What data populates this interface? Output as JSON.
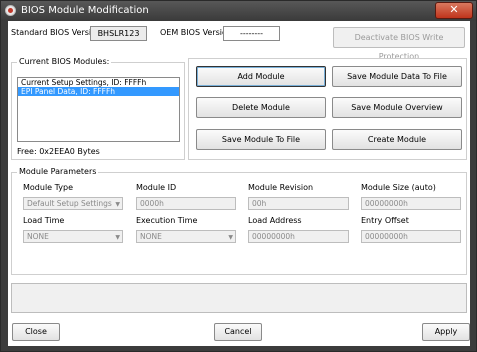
{
  "window": {
    "title": "BIOS Module Modification",
    "close_glyph": "✕"
  },
  "header": {
    "standard_label": "Standard BIOS Version:",
    "standard_value": "BHSLR123",
    "oem_label": "OEM BIOS Version:",
    "oem_value": "--------",
    "deactivate_label": "Deactivate BIOS Write Protection"
  },
  "modules": {
    "group_title": "Current BIOS Modules:",
    "items": [
      {
        "label": "Current Setup Settings, ID: FFFFh",
        "selected": false
      },
      {
        "label": "EPI Panel Data, ID: FFFFh",
        "selected": true
      }
    ],
    "free_text": "Free: 0x2EEA0 Bytes"
  },
  "actions": {
    "add": "Add  Module",
    "save_data": "Save Module Data To File",
    "delete": "Delete Module",
    "save_overview": "Save Module Overview",
    "save_to_file": "Save Module To File",
    "create": "Create Module"
  },
  "params": {
    "group_title": "Module Parameters",
    "type_label": "Module Type",
    "type_value": "Default Setup Settings",
    "id_label": "Module ID",
    "id_value": "0000h",
    "revision_label": "Module Revision",
    "revision_value": "00h",
    "size_label": "Module Size (auto)",
    "size_value": "00000000h",
    "load_time_label": "Load Time",
    "load_time_value": "NONE",
    "exec_time_label": "Execution Time",
    "exec_time_value": "NONE",
    "load_addr_label": "Load Address",
    "load_addr_value": "00000000h",
    "entry_label": "Entry Offset",
    "entry_value": "00000000h"
  },
  "footer": {
    "close": "Close",
    "cancel": "Cancel",
    "apply": "Apply"
  }
}
